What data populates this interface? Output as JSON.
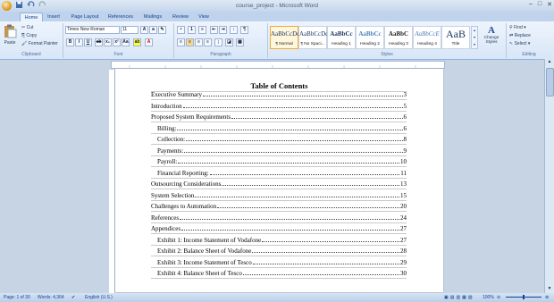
{
  "window": {
    "title": "course_project - Microsoft Word",
    "min": "–",
    "max": "□",
    "close": "✕"
  },
  "tabs": [
    "Home",
    "Insert",
    "Page Layout",
    "References",
    "Mailings",
    "Review",
    "View"
  ],
  "clipboard": {
    "paste": "Paste",
    "cut": "Cut",
    "copy": "Copy",
    "format_painter": "Format Painter",
    "label": "Clipboard"
  },
  "font": {
    "name": "Times New Roman",
    "size": "11",
    "label": "Font"
  },
  "paragraph": {
    "label": "Paragraph"
  },
  "styles": {
    "label": "Styles",
    "items": [
      {
        "sample": "AaBbCcDc",
        "name": "¶ Normal"
      },
      {
        "sample": "AaBbCcDc",
        "name": "¶ No Spaci..."
      },
      {
        "sample": "AaBbCc",
        "name": "Heading 1"
      },
      {
        "sample": "AaBbCc",
        "name": "Heading 2"
      },
      {
        "sample": "AaBbC",
        "name": "Heading 3"
      },
      {
        "sample": "AaBbCcE",
        "name": "Heading 4"
      },
      {
        "sample": "AaB",
        "name": "Title"
      }
    ],
    "change_styles": "Change Styles"
  },
  "editing": {
    "find": "Find",
    "replace": "Replace",
    "select": "Select",
    "label": "Editing"
  },
  "document": {
    "toc_title": "Table of Contents",
    "entries": [
      {
        "text": "Executive Summary",
        "page": "3",
        "level": 1
      },
      {
        "text": "Introduction",
        "page": "5",
        "level": 1
      },
      {
        "text": "Proposed System Requirements",
        "page": "6",
        "level": 1
      },
      {
        "text": "Billing:",
        "page": "6",
        "level": 2
      },
      {
        "text": "Collection:",
        "page": "8",
        "level": 2
      },
      {
        "text": "Payments:",
        "page": "9",
        "level": 2
      },
      {
        "text": "Payroll:",
        "page": "10",
        "level": 2
      },
      {
        "text": "Financial Reporting:",
        "page": "11",
        "level": 2
      },
      {
        "text": "Outsourcing Considerations",
        "page": "13",
        "level": 1
      },
      {
        "text": "System Selection",
        "page": "15",
        "level": 1
      },
      {
        "text": "Challenges to Automation",
        "page": "20",
        "level": 1
      },
      {
        "text": "References",
        "page": "24",
        "level": 1
      },
      {
        "text": "Appendices",
        "page": "27",
        "level": 1
      },
      {
        "text": "Exhibit 1: Income Statement of Vodafone",
        "page": "27",
        "level": 2
      },
      {
        "text": "Exhibit 2: Balance Sheet of Vodafone",
        "page": "28",
        "level": 2
      },
      {
        "text": "Exhibit 3: Income Statement of Tesco",
        "page": "29",
        "level": 2
      },
      {
        "text": "Exhibit 4: Balance Sheet of Tesco",
        "page": "30",
        "level": 2
      }
    ]
  },
  "status": {
    "page": "Page: 1 of 30",
    "words": "Words: 4,364",
    "language": "English (U.S.)",
    "zoom": "100%"
  }
}
